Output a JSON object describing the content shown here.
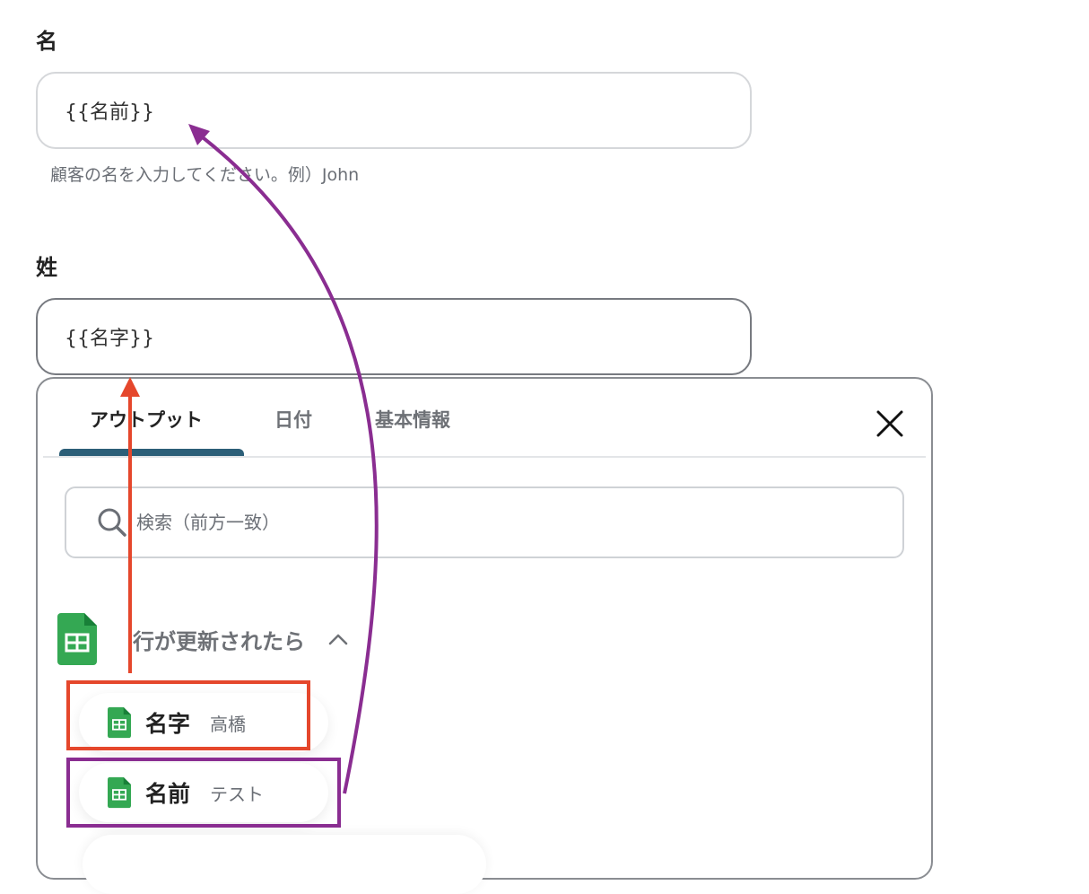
{
  "form": {
    "first_name": {
      "label": "名",
      "value": "{{名前}}",
      "help": "顧客の名を入力してください。例）John"
    },
    "last_name": {
      "label": "姓",
      "value": "{{名字}}"
    }
  },
  "dropdown": {
    "tabs": [
      {
        "label": "アウトプット",
        "active": true
      },
      {
        "label": "日付",
        "active": false
      },
      {
        "label": "基本情報",
        "active": false
      }
    ],
    "search": {
      "placeholder": "検索（前方一致）"
    },
    "group": {
      "title": "行が更新されたら",
      "icon": "google-sheets-icon"
    },
    "items": [
      {
        "name": "名字",
        "value": "高橋",
        "icon": "google-sheets-icon"
      },
      {
        "name": "名前",
        "value": "テスト",
        "icon": "google-sheets-icon"
      }
    ]
  },
  "colors": {
    "accent_tab": "#2c5f78",
    "highlight_red": "#e5472c",
    "highlight_purple": "#8a2d91",
    "sheets_green": "#34a853"
  }
}
